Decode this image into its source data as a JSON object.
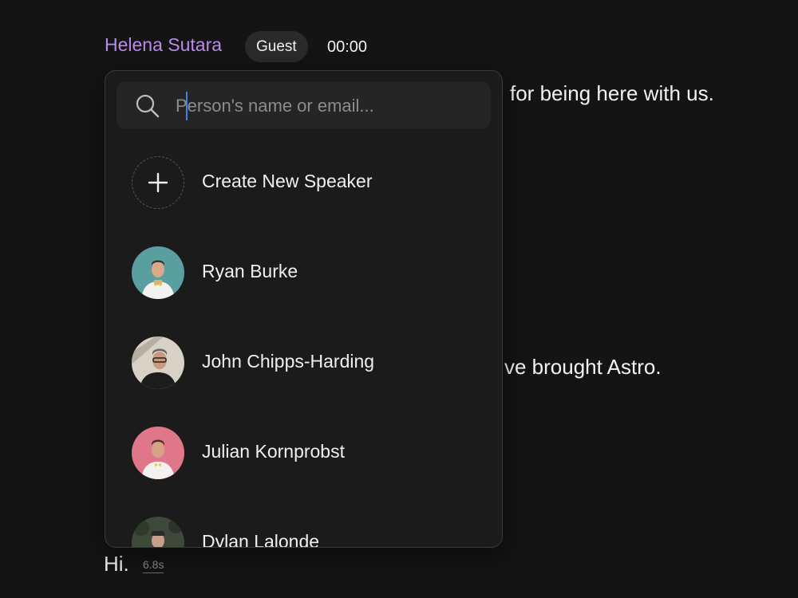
{
  "header": {
    "speaker_name": "Helena Sutara",
    "role_badge": "Guest",
    "timestamp": "00:00"
  },
  "transcript": {
    "line_1": "for being here with us.",
    "line_2": "ve brought Astro.",
    "line_3": "Hi.",
    "line_3_duration": "6.8s"
  },
  "popup": {
    "search": {
      "placeholder": "Person's name or email...",
      "value": ""
    },
    "create_label": "Create New Speaker",
    "speakers": [
      {
        "name": "Ryan Burke",
        "avatar_bg": "#5a9fa0",
        "avatar": "person-photo"
      },
      {
        "name": "John Chipps-Harding",
        "avatar_bg": "#cfc9bf",
        "avatar": "person-photo"
      },
      {
        "name": "Julian Kornprobst",
        "avatar_bg": "#e0768a",
        "avatar": "person-photo"
      },
      {
        "name": "Dylan Lalonde",
        "avatar_bg": "#3d4a3a",
        "avatar": "person-photo"
      }
    ]
  },
  "colors": {
    "background": "#141414",
    "popup_bg": "#1b1b1b",
    "speaker_name": "#b98be8",
    "caret": "#4a7fe0"
  }
}
